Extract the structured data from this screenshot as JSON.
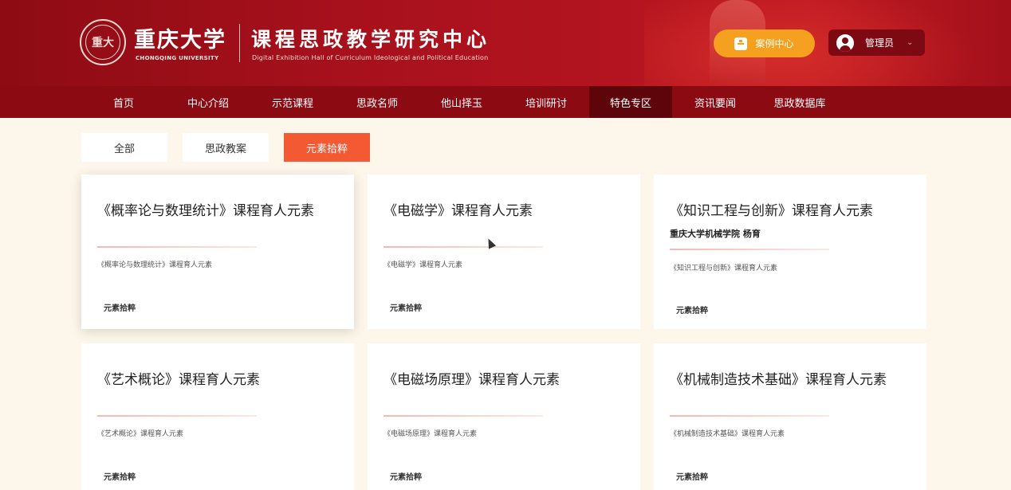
{
  "header": {
    "university_name": "重庆大学",
    "university_en": "CHONGQING UNIVERSITY",
    "seal_text": "重大",
    "site_title": "课程思政教学研究中心",
    "site_subtitle_en": "Digital Exhibition Hall of Curriculum Ideological and Political Education",
    "case_center_label": "案例中心",
    "user_label": "管理员",
    "chevron": "⌄"
  },
  "nav": {
    "items": [
      {
        "label": "首页"
      },
      {
        "label": "中心介绍"
      },
      {
        "label": "示范课程"
      },
      {
        "label": "思政名师"
      },
      {
        "label": "他山择玉"
      },
      {
        "label": "培训研讨"
      },
      {
        "label": "特色专区"
      },
      {
        "label": "资讯要闻"
      },
      {
        "label": "思政数据库"
      }
    ],
    "active": "特色专区"
  },
  "filters": {
    "items": [
      {
        "label": "全部"
      },
      {
        "label": "思政教案"
      },
      {
        "label": "元素拾粹"
      }
    ],
    "active": "元素拾粹"
  },
  "cards": [
    {
      "title": "《概率论与数理统计》课程育人元素",
      "desc": "《概率论与数理统计》课程育人元素",
      "tag": "元素拾粹"
    },
    {
      "title": "《电磁学》课程育人元素",
      "desc": "《电磁学》课程育人元素",
      "tag": "元素拾粹"
    },
    {
      "title": "《知识工程与创新》课程育人元素",
      "author": "重庆大学机械学院 杨育",
      "desc": "《知识工程与创新》课程育人元素",
      "tag": "元素拾粹"
    },
    {
      "title": "《艺术概论》课程育人元素",
      "desc": "《艺术概论》课程育人元素",
      "tag": "元素拾粹"
    },
    {
      "title": "《电磁场原理》课程育人元素",
      "desc": "《电磁场原理》课程育人元素",
      "tag": "元素拾粹"
    },
    {
      "title": "《机械制造技术基础》课程育人元素",
      "desc": "《机械制造技术基础》课程育人元素",
      "tag": "元素拾粹"
    }
  ],
  "colors": {
    "header_red": "#a7111c",
    "nav_red": "#8c0a12",
    "nav_active": "#5d050b",
    "accent_orange": "#f35a33",
    "case_btn": "#f5a11f",
    "page_bg": "#fdf6ea"
  }
}
